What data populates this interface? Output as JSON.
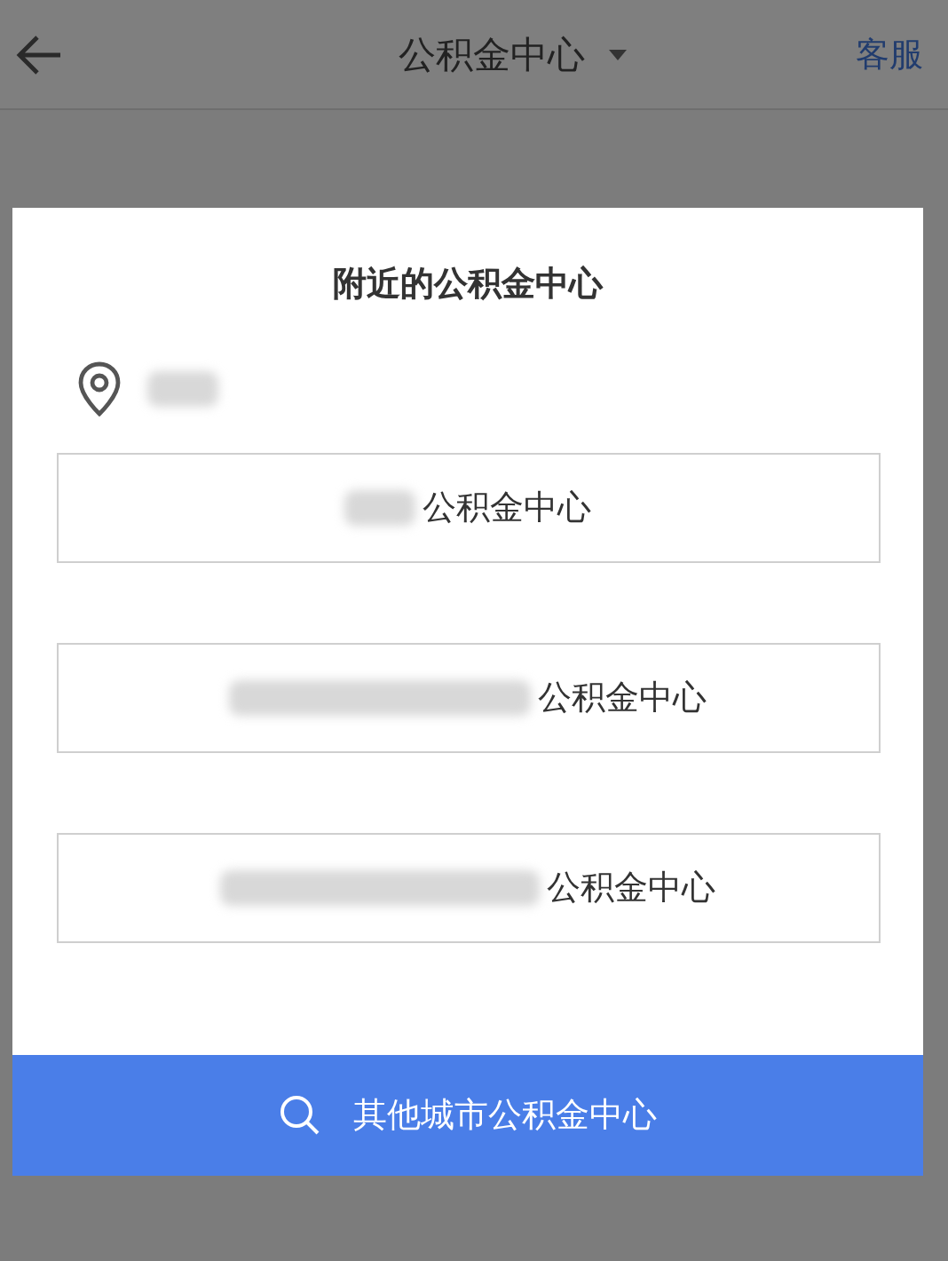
{
  "header": {
    "title": "公积金中心",
    "dropdown": true,
    "action": "客服"
  },
  "dialog": {
    "title": "附近的公积金中心",
    "location_blurred": true,
    "options": [
      {
        "label": "公积金中心",
        "blurred": true
      },
      {
        "label": "公积金中心",
        "blurred": true
      },
      {
        "label": "公积金中心",
        "blurred": true
      }
    ],
    "button": "其他城市公积金中心"
  }
}
